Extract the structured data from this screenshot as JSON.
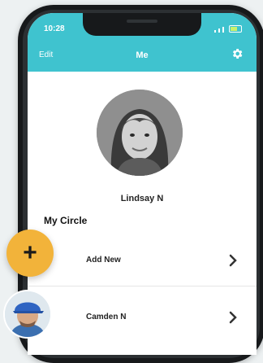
{
  "status": {
    "time": "10:28"
  },
  "header": {
    "edit_label": "Edit",
    "title": "Me",
    "settings_icon": "gear-icon"
  },
  "profile": {
    "name": "Lindsay N"
  },
  "circle": {
    "title": "My Circle",
    "add_label": "Add New",
    "members": [
      {
        "name": "Camden N"
      }
    ]
  },
  "fab": {
    "label": "+"
  },
  "colors": {
    "accent": "#3fc3cf",
    "fab": "#f2b33a"
  }
}
